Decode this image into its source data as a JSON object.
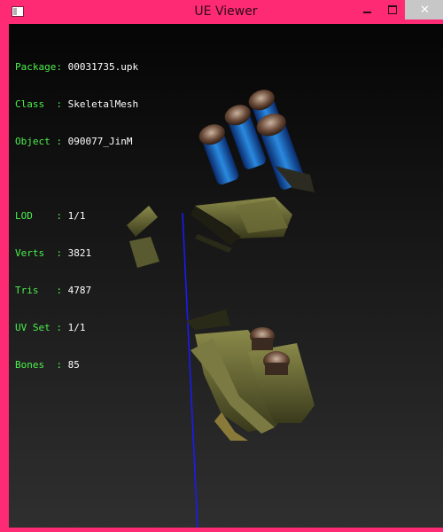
{
  "window": {
    "title": "UE Viewer"
  },
  "info": {
    "package_key": "Package: ",
    "package_value": "00031735.upk",
    "class_key": "Class  : ",
    "class_value": "SkeletalMesh",
    "object_key": "Object : ",
    "object_value": "090077_JinM",
    "lod_key": "LOD    : ",
    "lod_value": "1/1",
    "verts_key": "Verts  : ",
    "verts_value": "3821",
    "tris_key": "Tris   : ",
    "tris_value": "4787",
    "uvset_key": "UV Set : ",
    "uvset_value": "1/1",
    "bones_key": "Bones  : ",
    "bones_value": "85"
  },
  "colors": {
    "frame_accent": "#ff2a74",
    "label_green": "#4cf04c",
    "value_white": "#ffffff",
    "axis_blue": "#1a1aff"
  },
  "icons": {
    "app": "window-icon",
    "minimize": "minimize-icon",
    "maximize": "maximize-icon",
    "close": "close-icon"
  }
}
